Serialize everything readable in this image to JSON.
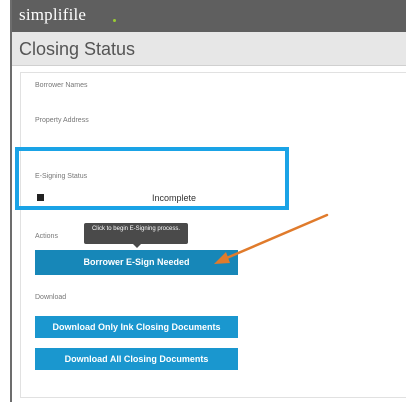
{
  "app": {
    "brand": "simplifile"
  },
  "page": {
    "title": "Closing Status"
  },
  "fields": {
    "borrower_names_label": "Borrower Names",
    "property_address_label": "Property Address",
    "esigning_status_label": "E-Signing Status",
    "esigning_status_value": "Incomplete"
  },
  "actions": {
    "section_label": "Actions",
    "tooltip_text": "Click to begin E-Signing process.",
    "esign_button_label": "Borrower E-Sign Needed"
  },
  "download": {
    "section_label": "Download",
    "ink_button_label": "Download Only Ink Closing Documents",
    "all_button_label": "Download All Closing Documents"
  },
  "colors": {
    "highlight": "#1aa3e6",
    "button": "#1a97cf",
    "annotation_arrow": "#e07b2c",
    "topbar": "#5f5f5f"
  }
}
